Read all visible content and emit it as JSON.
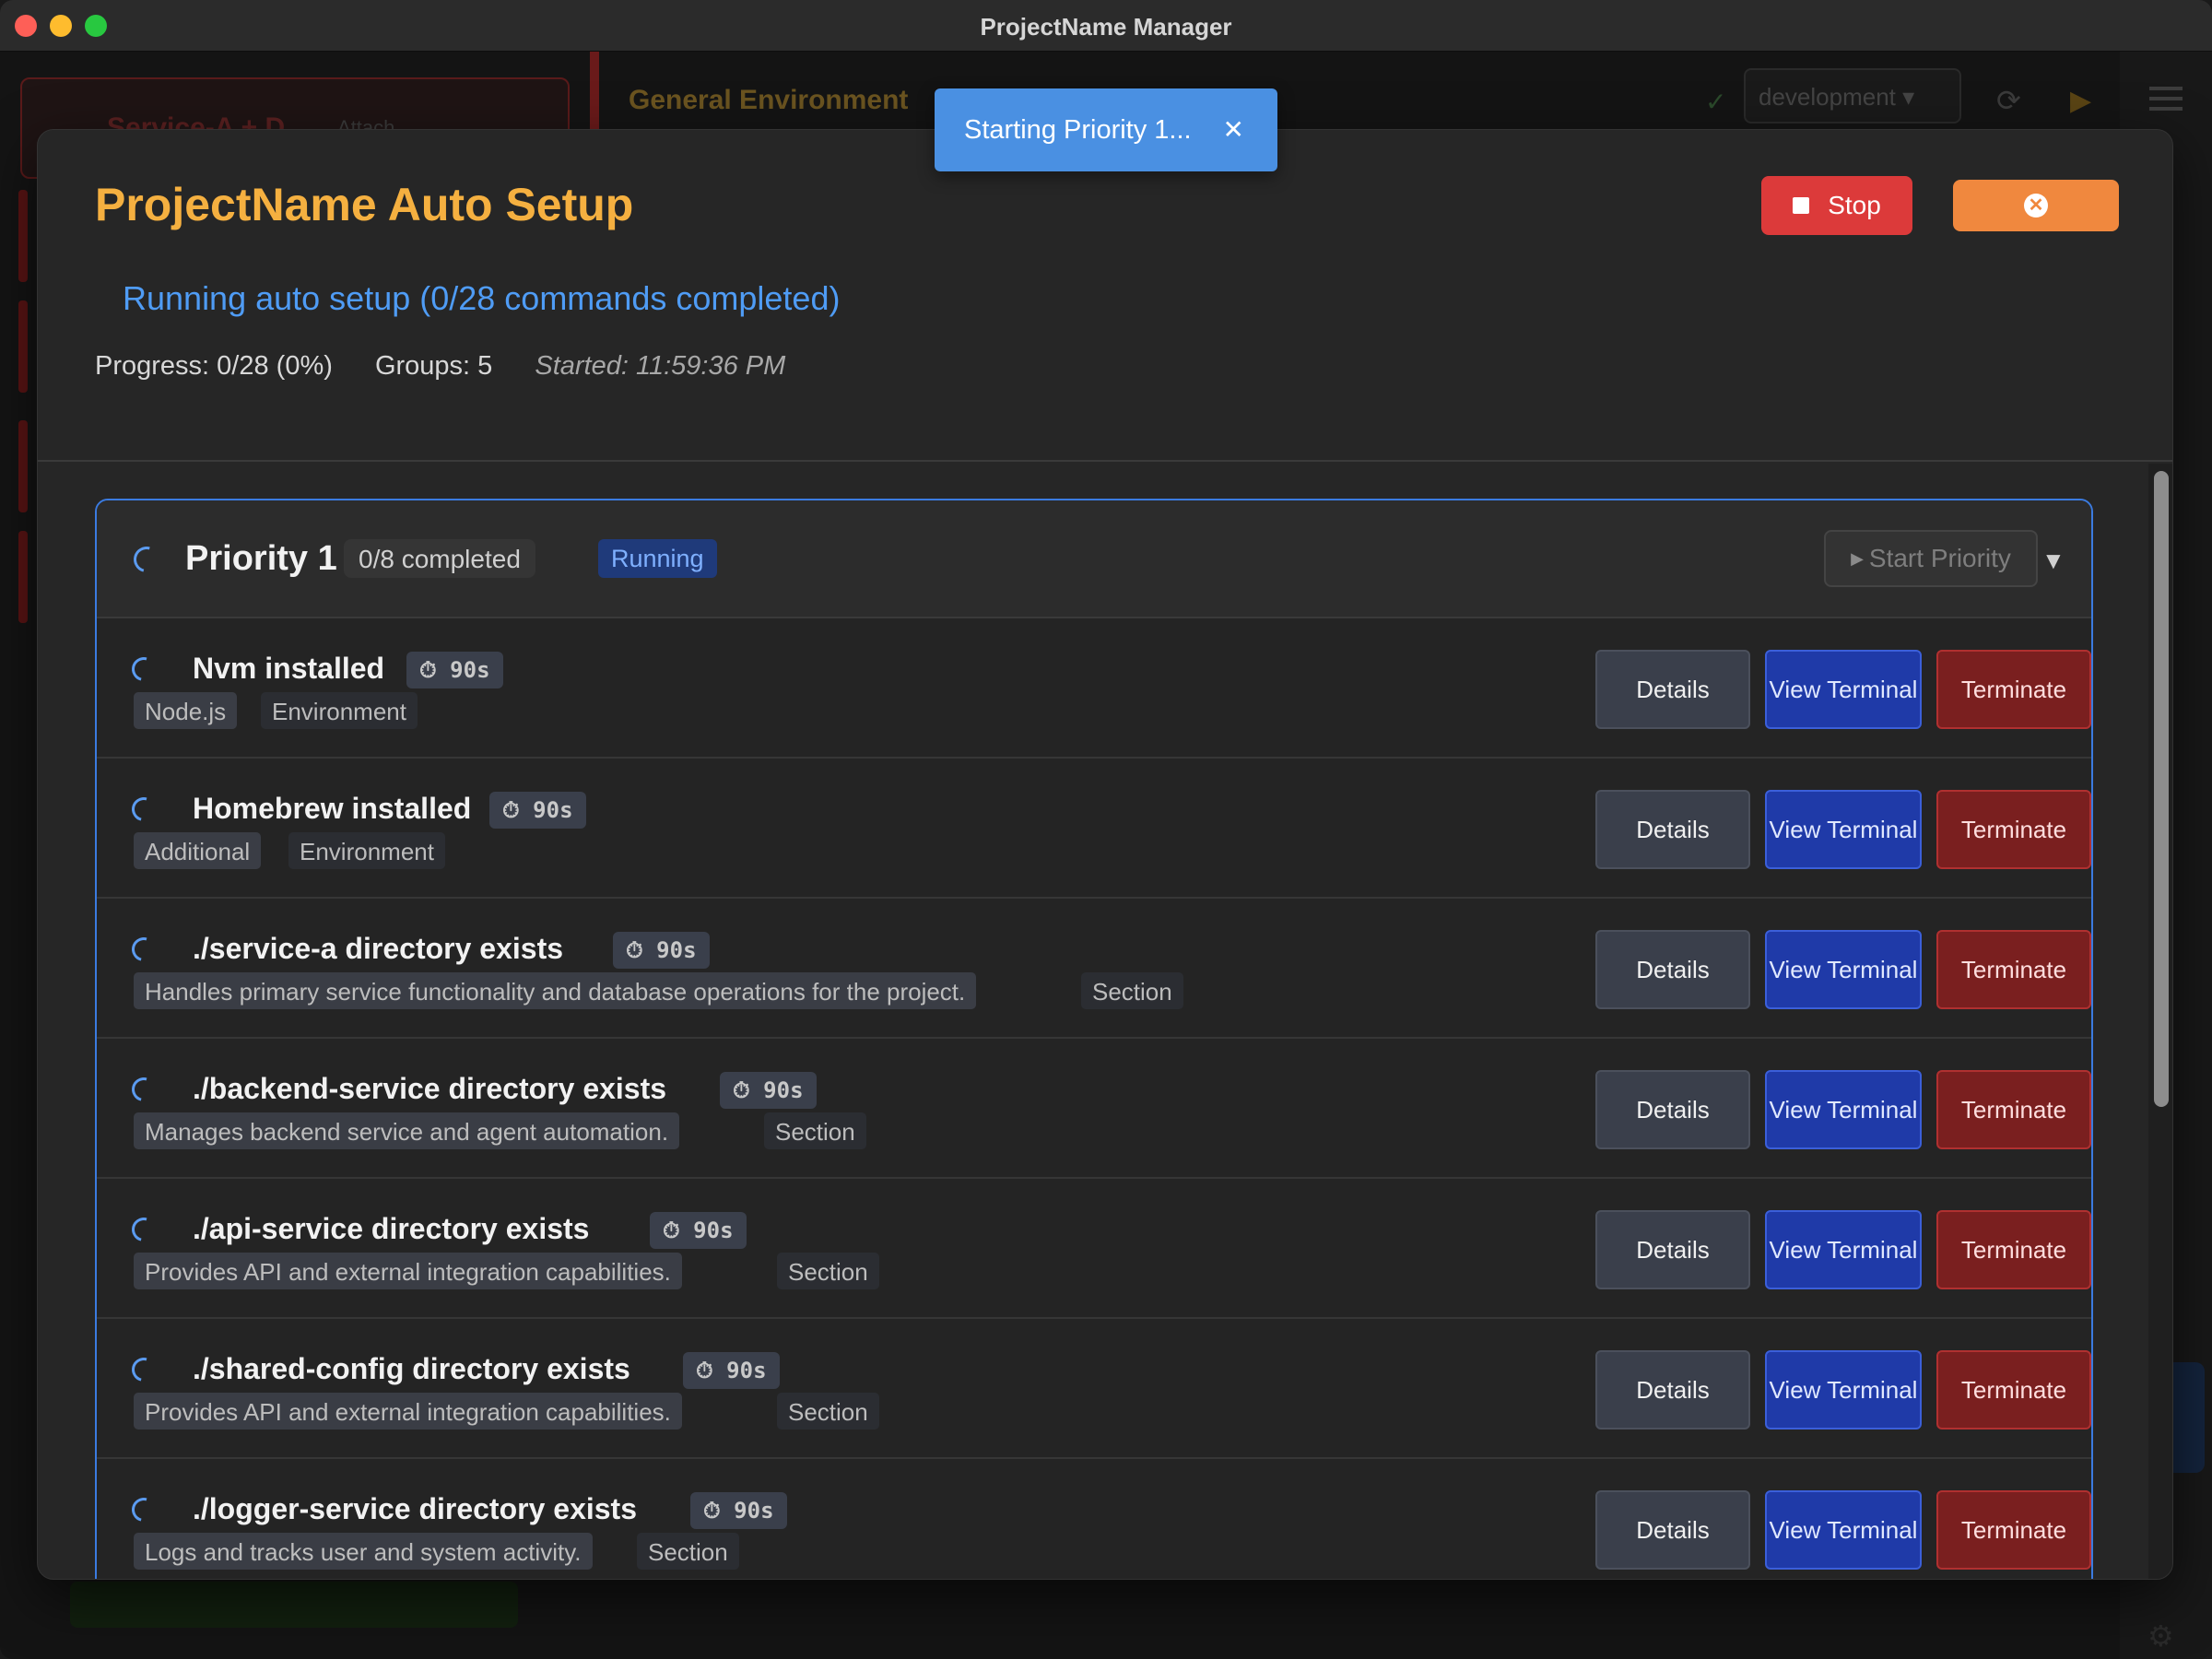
{
  "window": {
    "title": "ProjectName Manager"
  },
  "background": {
    "service_title": "Service-A + D",
    "service_attach": "Attach",
    "env_title": "General Environment",
    "env_select": "development"
  },
  "toast": {
    "message": "Starting Priority 1...",
    "close": "✕"
  },
  "modal": {
    "title": "ProjectName Auto Setup",
    "stop_label": "Stop",
    "close_icon": "⊗",
    "status": "Running auto setup (0/28 commands completed)",
    "progress": "Progress: 0/28 (0%)",
    "groups": "Groups: 5",
    "started": "Started: 11:59:36 PM"
  },
  "group": {
    "title": "Priority 1",
    "count": "0/8 completed",
    "status": "Running",
    "start_label": "Start Priority",
    "chevron": "▼"
  },
  "buttons": {
    "details": "Details",
    "view_terminal": "View Terminal",
    "terminate": "Terminate"
  },
  "commands": [
    {
      "name": "Nvm installed",
      "timer": "⏱ 90s",
      "tags": [
        "Node.js",
        "Environment"
      ]
    },
    {
      "name": "Homebrew installed",
      "timer": "⏱ 90s",
      "tags": [
        "Additional",
        "Environment"
      ]
    },
    {
      "name": "./service-a directory exists",
      "timer": "⏱ 90s",
      "tags": [
        "Handles primary service functionality and database operations for the project.",
        "Section"
      ]
    },
    {
      "name": "./backend-service directory exists",
      "timer": "⏱ 90s",
      "tags": [
        "Manages backend service and agent automation.",
        "Section"
      ]
    },
    {
      "name": "./api-service directory exists",
      "timer": "⏱ 90s",
      "tags": [
        "Provides API and external integration capabilities.",
        "Section"
      ]
    },
    {
      "name": "./shared-config directory exists",
      "timer": "⏱ 90s",
      "tags": [
        "Provides API and external integration capabilities.",
        "Section"
      ]
    },
    {
      "name": "./logger-service directory exists",
      "timer": "⏱ 90s",
      "tags": [
        "Logs and tracks user and system activity.",
        "Section"
      ]
    }
  ],
  "colors": {
    "accent_title": "#f5b040",
    "status_blue": "#4f9cf5",
    "stop_red": "#dc3a3a",
    "close_orange": "#f0883e",
    "group_border": "#3b7be0"
  }
}
